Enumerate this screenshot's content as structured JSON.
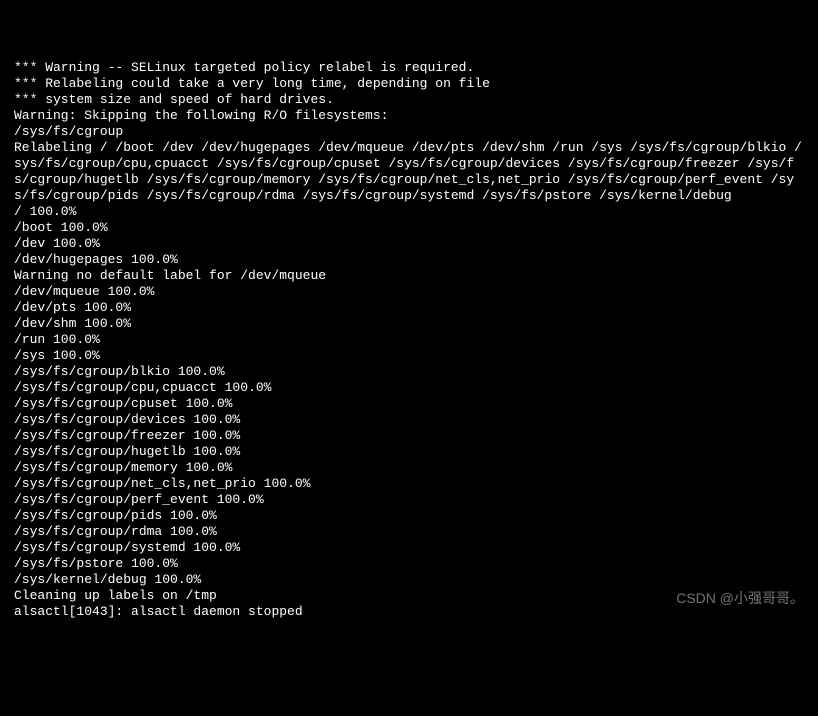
{
  "terminal": {
    "lines": [
      "*** Warning -- SELinux targeted policy relabel is required.",
      "*** Relabeling could take a very long time, depending on file",
      "*** system size and speed of hard drives.",
      "Warning: Skipping the following R/O filesystems:",
      "/sys/fs/cgroup",
      "Relabeling / /boot /dev /dev/hugepages /dev/mqueue /dev/pts /dev/shm /run /sys /sys/fs/cgroup/blkio /sys/fs/cgroup/cpu,cpuacct /sys/fs/cgroup/cpuset /sys/fs/cgroup/devices /sys/fs/cgroup/freezer /sys/fs/cgroup/hugetlb /sys/fs/cgroup/memory /sys/fs/cgroup/net_cls,net_prio /sys/fs/cgroup/perf_event /sys/fs/cgroup/pids /sys/fs/cgroup/rdma /sys/fs/cgroup/systemd /sys/fs/pstore /sys/kernel/debug",
      "/ 100.0%",
      "/boot 100.0%",
      "/dev 100.0%",
      "/dev/hugepages 100.0%",
      "Warning no default label for /dev/mqueue",
      "/dev/mqueue 100.0%",
      "/dev/pts 100.0%",
      "/dev/shm 100.0%",
      "/run 100.0%",
      "/sys 100.0%",
      "/sys/fs/cgroup/blkio 100.0%",
      "/sys/fs/cgroup/cpu,cpuacct 100.0%",
      "/sys/fs/cgroup/cpuset 100.0%",
      "/sys/fs/cgroup/devices 100.0%",
      "/sys/fs/cgroup/freezer 100.0%",
      "/sys/fs/cgroup/hugetlb 100.0%",
      "/sys/fs/cgroup/memory 100.0%",
      "/sys/fs/cgroup/net_cls,net_prio 100.0%",
      "/sys/fs/cgroup/perf_event 100.0%",
      "/sys/fs/cgroup/pids 100.0%",
      "/sys/fs/cgroup/rdma 100.0%",
      "/sys/fs/cgroup/systemd 100.0%",
      "/sys/fs/pstore 100.0%",
      "/sys/kernel/debug 100.0%",
      "",
      "Cleaning up labels on /tmp",
      "alsactl[1043]: alsactl daemon stopped"
    ]
  },
  "watermark": "CSDN @小强哥哥。"
}
